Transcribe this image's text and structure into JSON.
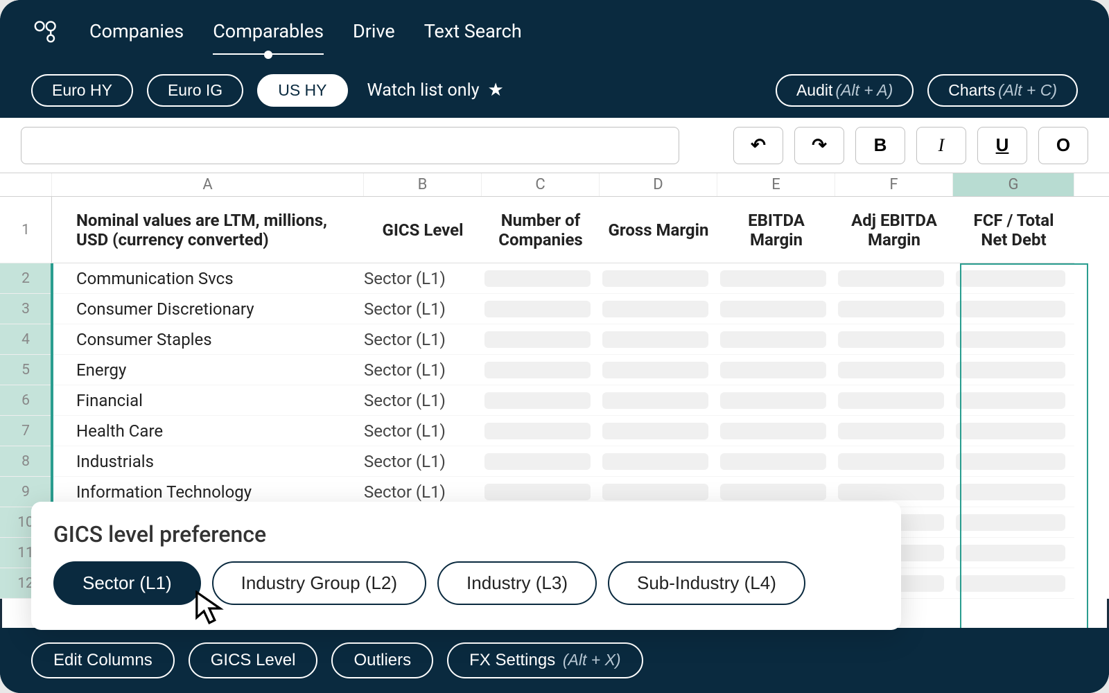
{
  "nav": {
    "items": [
      "Companies",
      "Comparables",
      "Drive",
      "Text Search"
    ],
    "active_index": 1
  },
  "filters": {
    "pills": [
      {
        "label": "Euro HY",
        "active": false
      },
      {
        "label": "Euro IG",
        "active": false
      },
      {
        "label": "US HY",
        "active": true
      }
    ],
    "watch_label": "Watch list only",
    "audit_label": "Audit",
    "audit_hint": "(Alt + A)",
    "charts_label": "Charts",
    "charts_hint": "(Alt + C)"
  },
  "toolbar": {
    "formula_value": "",
    "bold": "B",
    "italic": "I",
    "underline": "U",
    "other": "O"
  },
  "sheet": {
    "columns": [
      "A",
      "B",
      "C",
      "D",
      "E",
      "F",
      "G"
    ],
    "selected_column": "G",
    "headers": [
      "Nominal values are LTM, millions, USD (currency converted)",
      "GICS Level",
      "Number of Companies",
      "Gross Margin",
      "EBITDA Margin",
      "Adj EBITDA Margin",
      "FCF / Total Net Debt"
    ],
    "rows": [
      {
        "n": 2,
        "name": "Communication Svcs",
        "level": "Sector (L1)"
      },
      {
        "n": 3,
        "name": "Consumer Discretionary",
        "level": "Sector (L1)"
      },
      {
        "n": 4,
        "name": "Consumer Staples",
        "level": "Sector (L1)"
      },
      {
        "n": 5,
        "name": "Energy",
        "level": "Sector (L1)"
      },
      {
        "n": 6,
        "name": "Financial",
        "level": "Sector (L1)"
      },
      {
        "n": 7,
        "name": "Health Care",
        "level": "Sector (L1)"
      },
      {
        "n": 8,
        "name": "Industrials",
        "level": "Sector (L1)"
      },
      {
        "n": 9,
        "name": "Information Technology",
        "level": "Sector (L1)"
      },
      {
        "n": 10,
        "name": "",
        "level": ""
      },
      {
        "n": 11,
        "name": "",
        "level": ""
      },
      {
        "n": 12,
        "name": "",
        "level": ""
      }
    ]
  },
  "popover": {
    "title": "GICS level preference",
    "options": [
      "Sector (L1)",
      "Industry Group (L2)",
      "Industry (L3)",
      "Sub-Industry (L4)"
    ],
    "active_index": 0
  },
  "bottom": {
    "edit_columns": "Edit Columns",
    "gics_level": "GICS Level",
    "outliers": "Outliers",
    "fx_settings": "FX Settings",
    "fx_hint": "(Alt + X)"
  }
}
